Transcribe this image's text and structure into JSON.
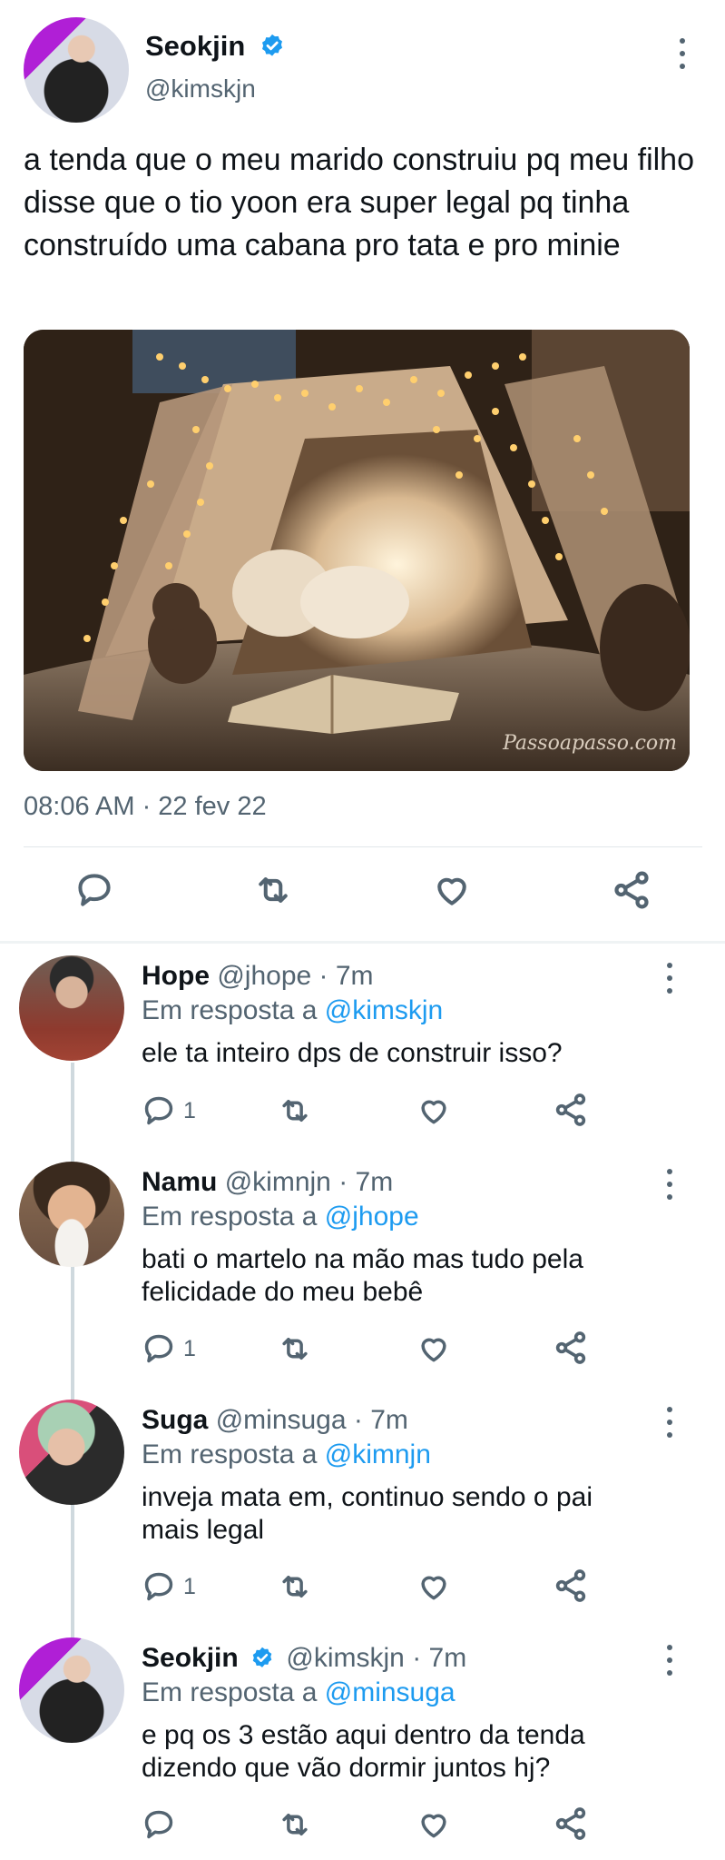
{
  "main_tweet": {
    "name": "Seokjin",
    "handle": "@kimskjn",
    "text": "a tenda que o meu marido construiu pq meu filho disse que o tio yoon era super legal pq tinha construído uma cabana pro tata e pro minie",
    "image_watermark": "Passoapasso.com",
    "timestamp": "08:06 AM · 22 fev 22",
    "avatar_icon": "profile-photo",
    "verified_color": "#1d9bf0"
  },
  "replies": [
    {
      "name": "Hope",
      "handle": "@jhope",
      "time": "· 7m",
      "reply_prefix": "Em resposta a",
      "reply_to": "@kimskjn",
      "text": "ele ta inteiro dps de construir isso?",
      "reply_count": "1",
      "verified": false
    },
    {
      "name": "Namu",
      "handle": "@kimnjn",
      "time": "· 7m",
      "reply_prefix": "Em resposta a",
      "reply_to": "@jhope",
      "text": "bati o martelo na mão mas tudo pela felicidade do meu bebê",
      "reply_count": "1",
      "verified": false
    },
    {
      "name": "Suga",
      "handle": "@minsuga",
      "time": "· 7m",
      "reply_prefix": "Em resposta a",
      "reply_to": "@kimnjn",
      "text": "inveja mata em, continuo sendo o pai mais legal",
      "reply_count": "1",
      "verified": false
    },
    {
      "name": "Seokjin",
      "handle": "@kimskjn",
      "time": "· 7m",
      "reply_prefix": "Em resposta a",
      "reply_to": "@minsuga",
      "text": "e pq os 3 estão aqui dentro da tenda dizendo que vão dormir juntos hj?",
      "reply_count": "",
      "verified": true
    }
  ],
  "colors": {
    "accent": "#1d9bf0",
    "text": "#0f1419",
    "muted": "#536471"
  }
}
